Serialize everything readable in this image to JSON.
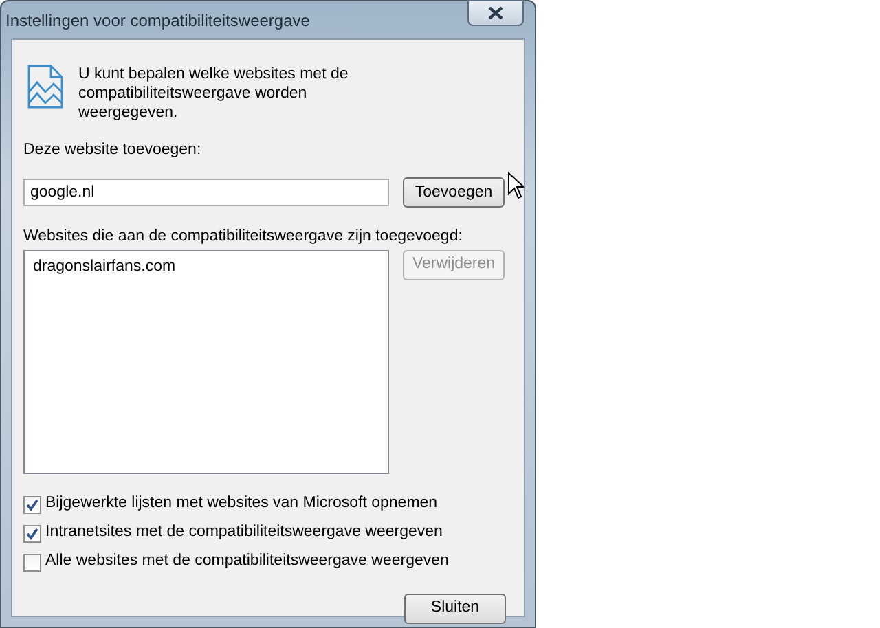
{
  "window": {
    "title": "Instellingen voor compatibiliteitsweergave"
  },
  "intro": "U kunt bepalen welke websites met de compatibiliteitsweergave worden weergegeven.",
  "add_label": "Deze website toevoegen:",
  "url_field": {
    "value": "google.nl"
  },
  "buttons": [
    {
      "label": "Toevoegen",
      "disabled": false
    },
    {
      "label": "Verwijderen",
      "disabled": true
    },
    {
      "label": "Sluiten",
      "disabled": false
    }
  ],
  "list_label": "Websites die aan de compatibiliteitsweergave zijn toegevoegd:",
  "websites": [
    "dragonslairfans.com"
  ],
  "options": [
    {
      "label": "Bijgewerkte lijsten met websites van Microsoft opnemen",
      "checked": true
    },
    {
      "label": "Intranetsites met de compatibiliteitsweergave weergeven",
      "checked": true
    },
    {
      "label": "Alle websites met de compatibiliteitsweergave weergeven",
      "checked": false
    }
  ]
}
